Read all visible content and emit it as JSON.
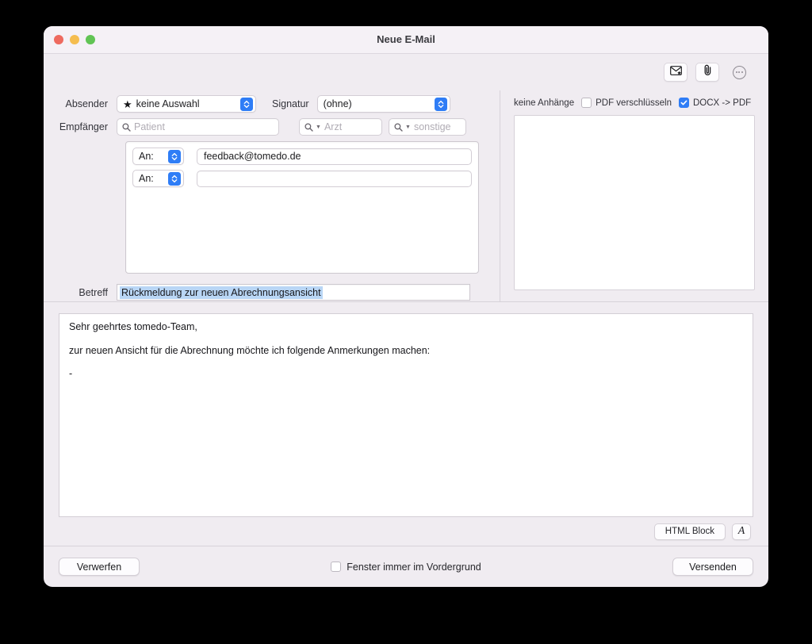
{
  "window": {
    "title": "Neue E-Mail",
    "traffic_lights": [
      "close-button",
      "minimize-button",
      "maximize-button"
    ]
  },
  "toolbar": {
    "mail_icon": "envelope-star-icon",
    "attach_icon": "paperclip-icon",
    "more_icon": "ellipsis-circle-icon"
  },
  "form": {
    "absender_label": "Absender",
    "absender_value": "keine Auswahl",
    "signatur_label": "Signatur",
    "signatur_value": "(ohne)",
    "empfaenger_label": "Empfänger",
    "patient_placeholder": "Patient",
    "arzt_placeholder": "Arzt",
    "sonstige_placeholder": "sonstige",
    "betreff_label": "Betreff",
    "betreff_value": "Rückmeldung zur neuen Abrechnungsansicht"
  },
  "recipients": [
    {
      "type": "An:",
      "address": "feedback@tomedo.de"
    },
    {
      "type": "An:",
      "address": ""
    }
  ],
  "attachments": {
    "status": "keine Anhänge",
    "encrypt_pdf_label": "PDF verschlüsseln",
    "encrypt_pdf_checked": false,
    "docx_to_pdf_label": "DOCX -> PDF",
    "docx_to_pdf_checked": true
  },
  "body": {
    "lines": [
      "Sehr geehrtes tomedo-Team,",
      "zur neuen Ansicht für die Abrechnung möchte ich folgende Anmerkungen machen:",
      "-"
    ]
  },
  "format_bar": {
    "html_block_label": "HTML Block",
    "font_label": "A"
  },
  "footer": {
    "discard_label": "Verwerfen",
    "always_front_label": "Fenster immer im Vordergrund",
    "always_front_checked": false,
    "send_label": "Versenden"
  },
  "colors": {
    "accent": "#2f7df6",
    "window_bg": "#f0ecf1",
    "selection": "#b9d6f5"
  }
}
